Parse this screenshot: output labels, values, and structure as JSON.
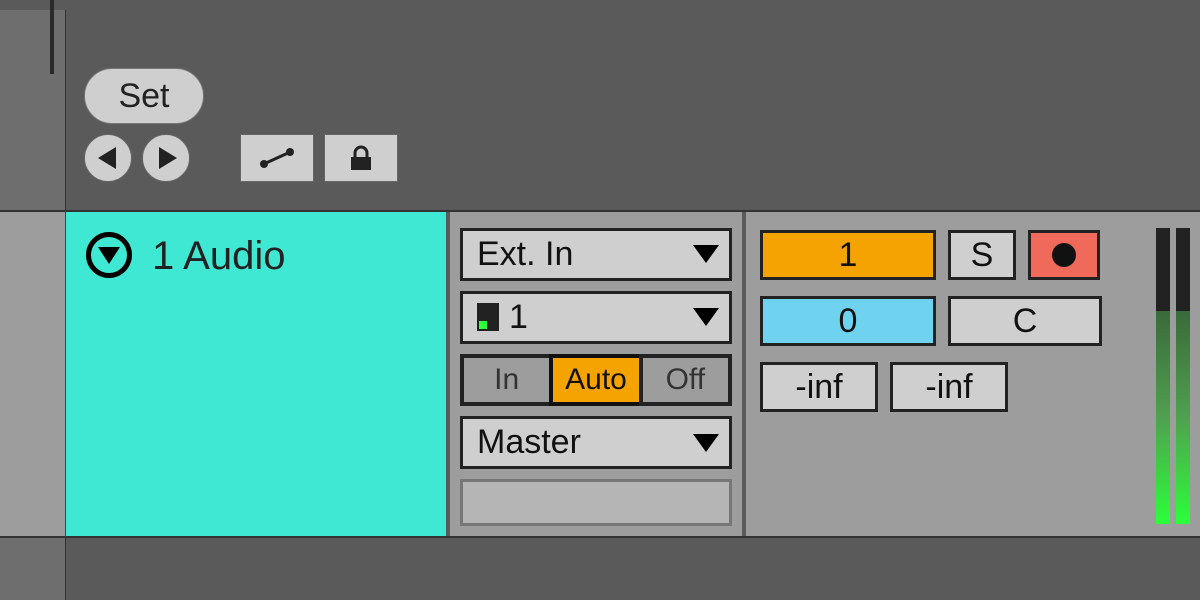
{
  "toolbar": {
    "set_label": "Set"
  },
  "track": {
    "title": "1 Audio"
  },
  "io": {
    "input_type": "Ext. In",
    "input_channel": "1",
    "monitor_in": "In",
    "monitor_auto": "Auto",
    "monitor_off": "Off",
    "output_routing": "Master"
  },
  "mixer": {
    "track_activator": "1",
    "send_value": "0",
    "solo_label": "S",
    "crossfade_label": "C",
    "vol_left": "-inf",
    "vol_right": "-inf"
  }
}
